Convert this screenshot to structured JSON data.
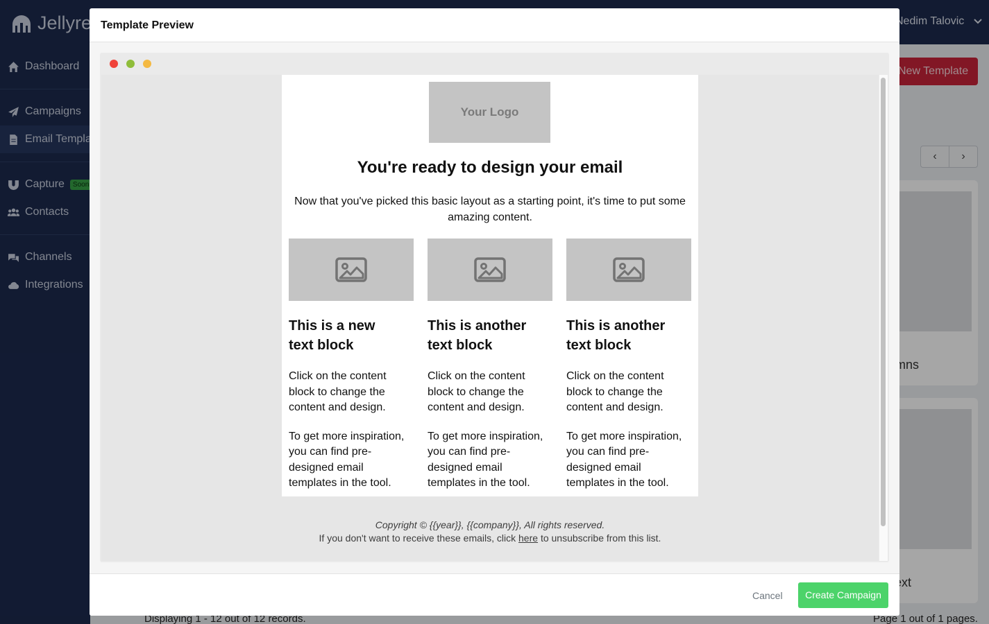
{
  "app": {
    "brand": "Jellyre",
    "user_name": "Nedim Talovic"
  },
  "sidebar": {
    "items": [
      {
        "label": "Dashboard"
      },
      {
        "label": "Campaigns"
      },
      {
        "label": "Email Templates"
      },
      {
        "label": "Capture",
        "badge": "Soon"
      },
      {
        "label": "Contacts"
      },
      {
        "label": "Channels"
      },
      {
        "label": "Integrations"
      }
    ]
  },
  "main": {
    "new_template_label": "New Template",
    "prev_icon": "‹",
    "next_icon": "›",
    "cards": [
      {
        "label": "umns"
      },
      {
        "label": "Text"
      }
    ],
    "records": "Displaying 1 - 12 out of 12 records.",
    "pages": "Page 1 out of 1 pages."
  },
  "modal": {
    "title": "Template Preview",
    "email": {
      "logo_text": "Your Logo",
      "headline": "You're ready to design your email",
      "intro": "Now that you've picked this basic layout as a starting point, it's time to put some amazing content.",
      "columns": [
        {
          "title": "This is a new text block",
          "text": "Click on the content block to change the content and design.",
          "text2": "To get more inspiration, you can find pre-designed email templates in the tool."
        },
        {
          "title": "This is another text block",
          "text": "Click on the content block to change the content and design.",
          "text2": "To get more inspiration, you can find pre-designed email templates in the tool."
        },
        {
          "title": "This is another text block",
          "text": "Click on the content block to change the content and design.",
          "text2": "To get more inspiration, you can find pre-designed email templates in the tool."
        }
      ],
      "footer_copyright": "Copyright © {{year}}, {{company}}, All rights reserved.",
      "footer_unsub_prefix": "If you don't want to receive these emails, click",
      "footer_unsub_link": "here",
      "footer_unsub_suffix": "to unsubscribe from this list."
    },
    "cancel_label": "Cancel",
    "create_label": "Create Campaign"
  },
  "colors": {
    "navy": "#1c2a4e",
    "primary_red": "#c8243a",
    "success_green": "#4cd36a"
  }
}
